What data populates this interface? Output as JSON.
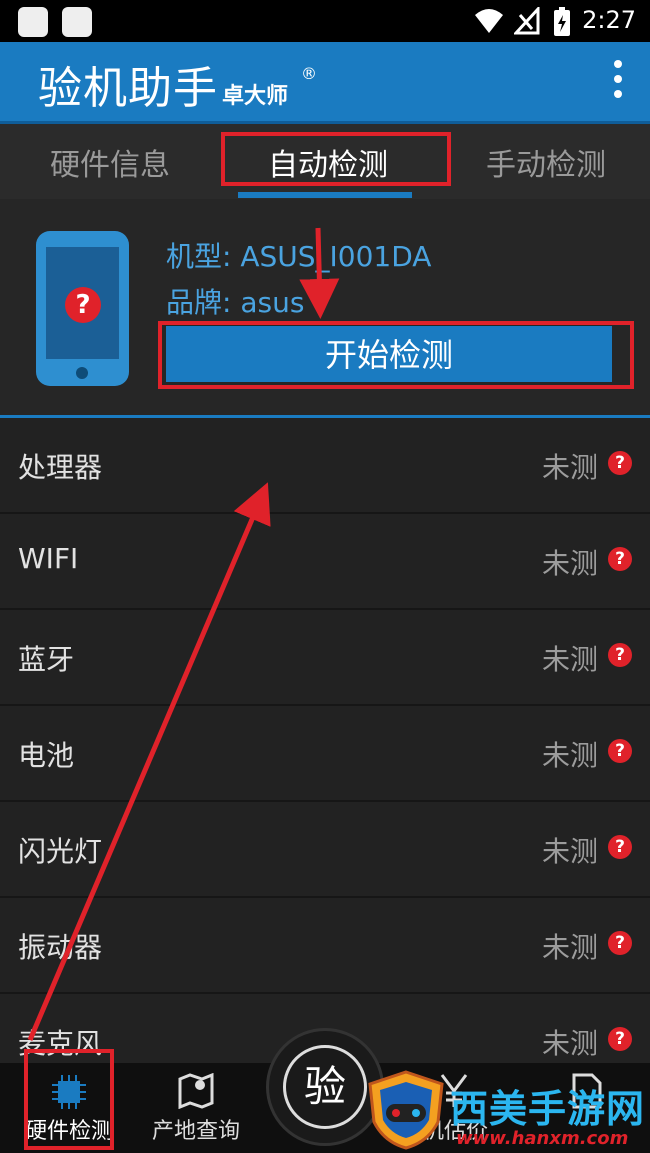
{
  "status_bar": {
    "time": "2:27"
  },
  "app_bar": {
    "title": "验机助手",
    "subtitle": "卓大师",
    "registered": "®"
  },
  "tabs": [
    {
      "label": "硬件信息"
    },
    {
      "label": "自动检测"
    },
    {
      "label": "手动检测"
    }
  ],
  "device": {
    "model_label": "机型: ASUS_I001DA",
    "brand_label": "品牌: asus",
    "phone_badge": "?",
    "start_button": "开始检测"
  },
  "tests": [
    {
      "name": "处理器",
      "status": "未测"
    },
    {
      "name": "WIFI",
      "status": "未测"
    },
    {
      "name": "蓝牙",
      "status": "未测"
    },
    {
      "name": "电池",
      "status": "未测"
    },
    {
      "name": "闪光灯",
      "status": "未测"
    },
    {
      "name": "振动器",
      "status": "未测"
    },
    {
      "name": "麦克风",
      "status": "未测"
    }
  ],
  "status_badge": "?",
  "bottom_nav": {
    "hardware": "硬件检测",
    "origin": "产地查询",
    "center": "验",
    "price": "机估价"
  },
  "watermark": {
    "text": "西美手游网",
    "url": "www.hanxm.com"
  },
  "colors": {
    "accent": "#1a7bc1",
    "highlight": "#e0222a"
  }
}
